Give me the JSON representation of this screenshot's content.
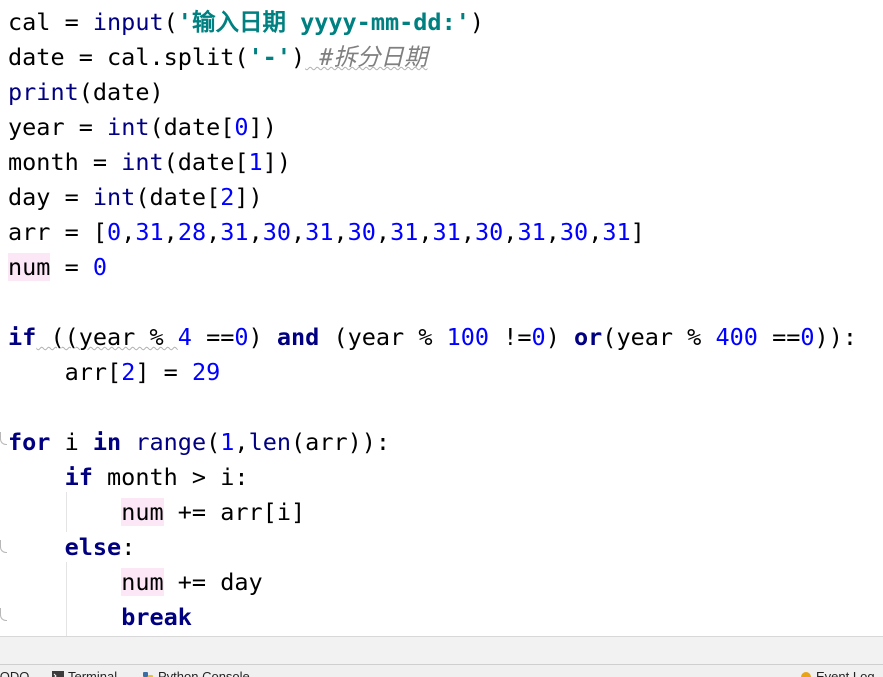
{
  "editor": {
    "lines": {
      "l1": {
        "a": "cal = ",
        "b": "input",
        "c": "(",
        "d": "'输入日期 yyyy-mm-dd:'",
        "e": ")"
      },
      "l2": {
        "a": "date = cal.split(",
        "b": "'-'",
        "c": ")",
        "d": " #拆分日期"
      },
      "l3": {
        "a": "print",
        "b": "(date)"
      },
      "l4": {
        "a": "year = ",
        "b": "int",
        "c": "(date[",
        "d": "0",
        "e": "])"
      },
      "l5": {
        "a": "month = ",
        "b": "int",
        "c": "(date[",
        "d": "1",
        "e": "])"
      },
      "l6": {
        "a": "day = ",
        "b": "int",
        "c": "(date[",
        "d": "2",
        "e": "])"
      },
      "l7": {
        "a": "arr = [",
        "nums": [
          "0",
          "31",
          "28",
          "31",
          "30",
          "31",
          "30",
          "31",
          "31",
          "30",
          "31",
          "30",
          "31"
        ],
        "z": "]"
      },
      "l8": {
        "a": "num",
        "b": " = ",
        "c": "0"
      },
      "l9": {
        "a": "if",
        "b": " ((year % ",
        "c": "4",
        "d": " ==",
        "e": "0",
        "f": ") ",
        "g": "and",
        "h": " (year % ",
        "i": "100",
        "j": " !=",
        "k": "0",
        "l": ") ",
        "m": "or",
        "n": "(year % ",
        "o": "400",
        "p": " ==",
        "q": "0",
        "r": ")):"
      },
      "l10": {
        "a": "    arr[",
        "b": "2",
        "c": "] = ",
        "d": "29"
      },
      "l11": {
        "a": "for",
        "b": " i ",
        "c": "in",
        "d": " ",
        "e": "range",
        "f": "(",
        "g": "1",
        "h": ",",
        "i": "len",
        "j": "(arr)):"
      },
      "l12": {
        "a": "    ",
        "b": "if",
        "c": " month > i:"
      },
      "l13": {
        "a": "        ",
        "b": "num",
        "c": " += arr[i]"
      },
      "l14": {
        "a": "    ",
        "b": "else",
        "c": ":"
      },
      "l15": {
        "a": "        ",
        "b": "num",
        "c": " += day"
      },
      "l16": {
        "a": "        ",
        "b": "break"
      }
    }
  },
  "bottom_toolbar": {
    "todo_label": "TODO",
    "terminal_label": "Terminal",
    "python_console_label": "Python Console",
    "event_log_label": "Event Log"
  },
  "colors": {
    "keyword": "#000080",
    "number": "#0000ff",
    "string": "#008080",
    "comment": "#808080",
    "highlight": "#fce7f7"
  }
}
